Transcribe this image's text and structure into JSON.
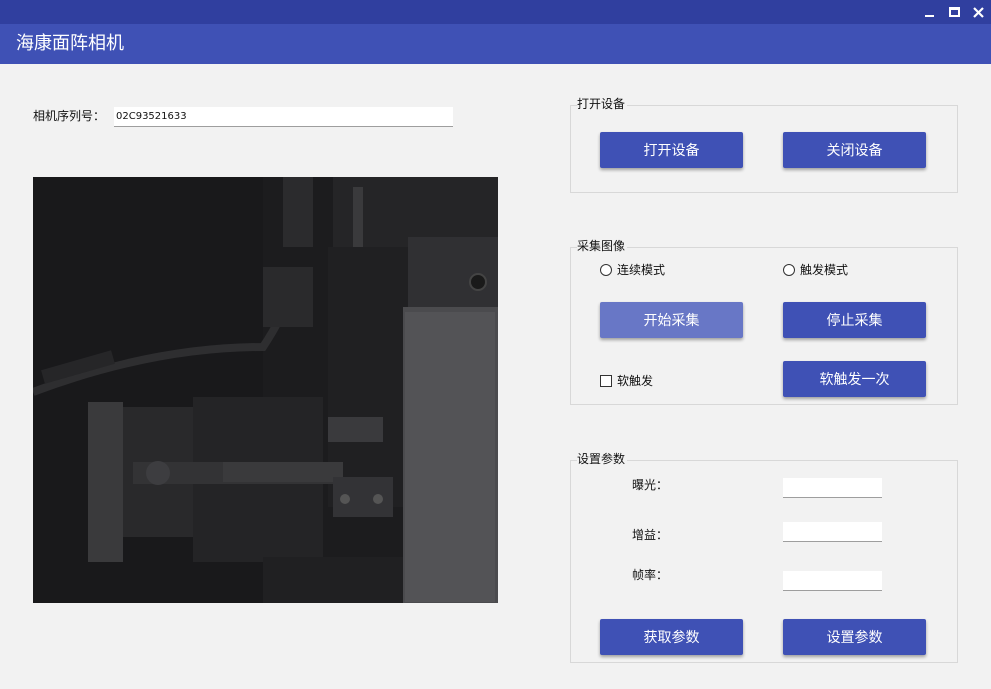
{
  "window": {
    "title": "海康面阵相机",
    "controls": {
      "minimize": "minimize-icon",
      "maximize": "maximize-icon",
      "close": "close-icon"
    },
    "accent_color": "#3f51b5"
  },
  "serial": {
    "label": "相机序列号：",
    "value": "02C93521633"
  },
  "device_group": {
    "title": "打开设备",
    "open_button": "打开设备",
    "close_button": "关闭设备"
  },
  "capture_group": {
    "title": "采集图像",
    "continuous_mode": "连续模式",
    "trigger_mode": "触发模式",
    "start_button": "开始采集",
    "stop_button": "停止采集",
    "soft_trigger_checkbox": "软触发",
    "soft_trigger_once_button": "软触发一次"
  },
  "params_group": {
    "title": "设置参数",
    "exposure_label": "曝光：",
    "exposure_value": "",
    "gain_label": "增益：",
    "gain_value": "",
    "framerate_label": "帧率：",
    "framerate_value": "",
    "get_button": "获取参数",
    "set_button": "设置参数"
  }
}
